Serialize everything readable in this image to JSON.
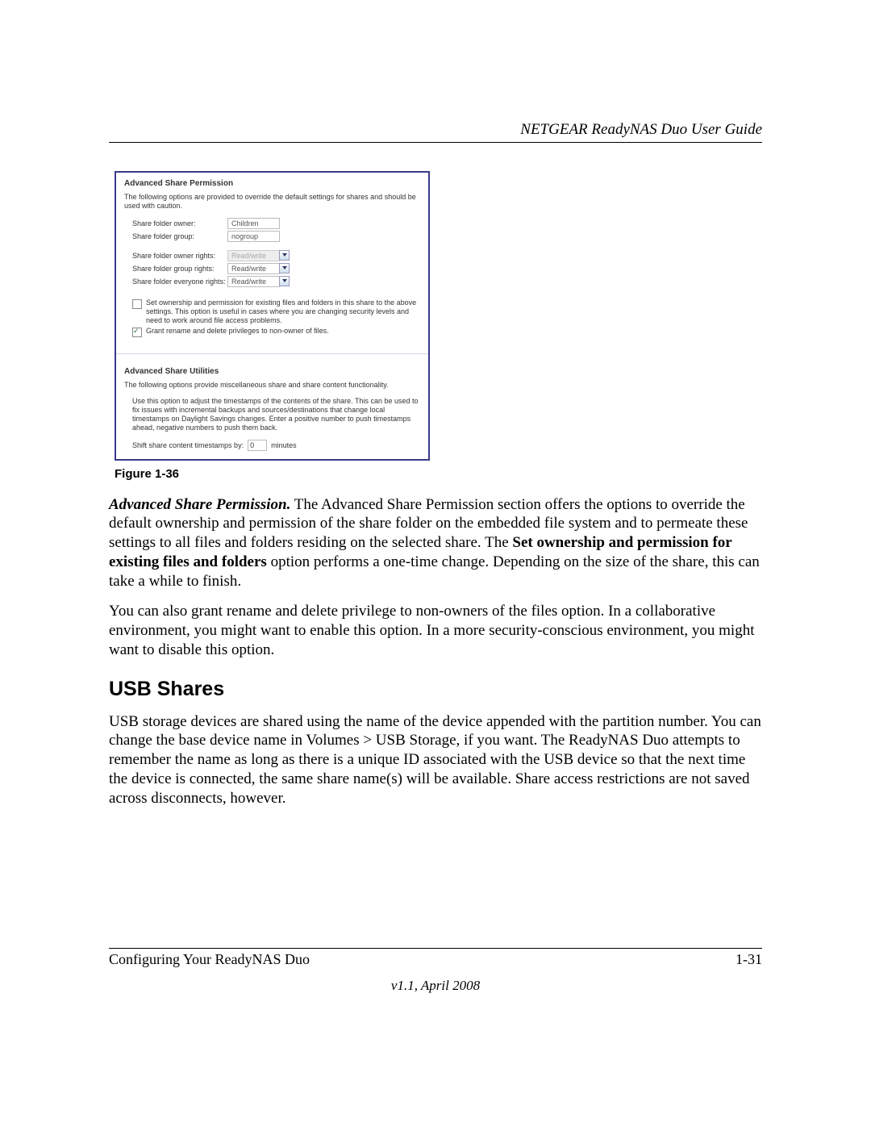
{
  "header": {
    "title": "NETGEAR ReadyNAS Duo User Guide"
  },
  "screenshot": {
    "panel1": {
      "title": "Advanced Share Permission",
      "desc": "The following options are provided to override the default settings for shares and should be used with caution.",
      "fields": {
        "owner": {
          "label": "Share folder owner:",
          "value": "Children"
        },
        "group": {
          "label": "Share folder group:",
          "value": "nogroup"
        },
        "orights": {
          "label": "Share folder owner rights:",
          "value": "Read/write"
        },
        "grights": {
          "label": "Share folder group rights:",
          "value": "Read/write"
        },
        "erights": {
          "label": "Share folder everyone rights:",
          "value": "Read/write"
        }
      },
      "chk1": "Set ownership and permission for existing files and folders in this share to the above settings. This option is useful in cases where you are changing security levels and need to work around file access problems.",
      "chk2": "Grant rename and delete privileges to non-owner of files."
    },
    "panel2": {
      "title": "Advanced Share Utilities",
      "desc": "The following options provide miscellaneous share and share content functionality.",
      "note": "Use this option to adjust the timestamps of the contents of the share. This can be used to fix issues with incremental backups and sources/destinations that change local timestamps on Daylight Savings changes. Enter a positive number to push timestamps ahead, negative numbers to push them back.",
      "shift_label": "Shift share content timestamps by:",
      "shift_value": "0",
      "shift_unit": "minutes"
    }
  },
  "figure_caption": "Figure 1-36",
  "body": {
    "p1_lead": "Advanced Share Permission.",
    "p1_rest": " The Advanced Share Permission section offers the options to override the default ownership and permission of the share folder on the embedded file system and to permeate these settings to all files and folders residing on the selected share. The ",
    "p1_bold": "Set ownership and permission for existing files and folders",
    "p1_tail": " option performs a one-time change. Depending on the size of the share, this can take a while to finish.",
    "p2": "You can also grant rename and delete privilege to non-owners of the files option. In a collaborative environment, you might want to enable this option. In a more security-conscious environment, you might want to disable this option.",
    "h2": "USB Shares",
    "p3": "USB storage devices are shared using the name of the device appended with the partition number. You can change the base device name in Volumes > USB Storage, if you want. The ReadyNAS Duo attempts to remember the name as long as there is a unique ID associated with the USB device so that the next time the device is connected, the same share name(s) will be available. Share access restrictions are not saved across disconnects, however."
  },
  "footer": {
    "left": "Configuring Your ReadyNAS Duo",
    "right": "1-31",
    "version": "v1.1, April 2008"
  }
}
